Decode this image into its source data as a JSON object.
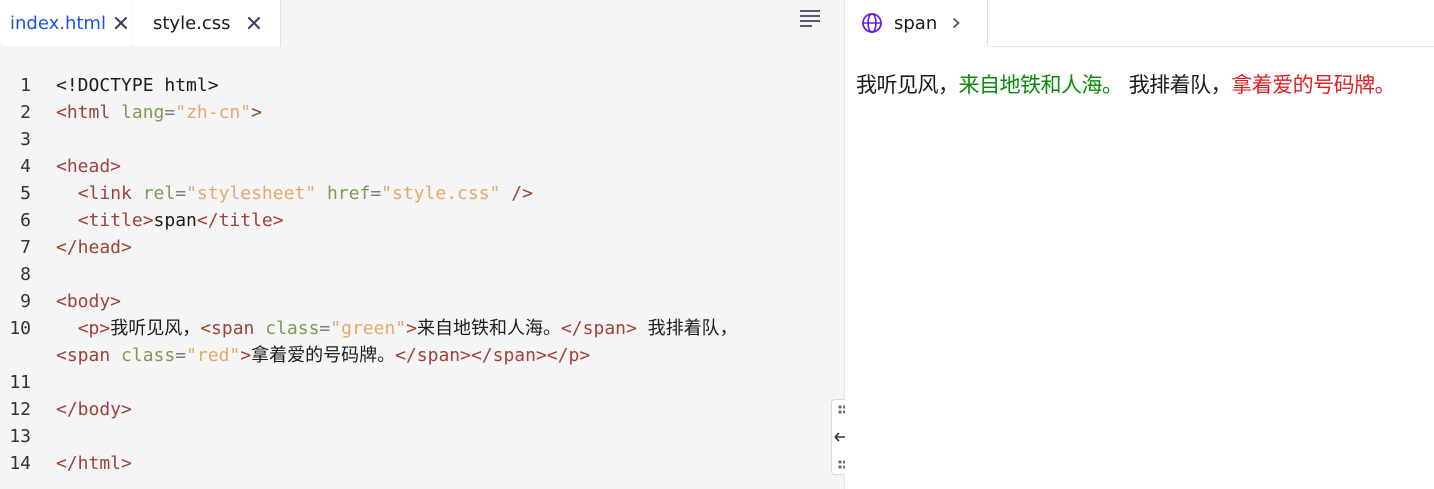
{
  "tabs": [
    {
      "label": "index.html",
      "active": true
    },
    {
      "label": "style.css",
      "active": false
    }
  ],
  "icons": {
    "close": "close-icon",
    "format": "format-lines-icon",
    "globe": "globe-icon",
    "chevron": "chevron-right-icon",
    "drag": "drag-dots-icon",
    "resize": "horizontal-resize-icon"
  },
  "code_lines": [
    {
      "num": "1",
      "tokens": [
        {
          "t": "doctype",
          "v": "<!DOCTYPE html>"
        }
      ]
    },
    {
      "num": "2",
      "tokens": [
        {
          "t": "tag",
          "v": "<html"
        },
        {
          "t": "text",
          "v": " "
        },
        {
          "t": "attr",
          "v": "lang"
        },
        {
          "t": "punct",
          "v": "="
        },
        {
          "t": "str",
          "v": "\"zh-cn\""
        },
        {
          "t": "tag",
          "v": ">"
        }
      ]
    },
    {
      "num": "3",
      "tokens": []
    },
    {
      "num": "4",
      "tokens": [
        {
          "t": "tag",
          "v": "<head>"
        }
      ]
    },
    {
      "num": "5",
      "tokens": [
        {
          "t": "text",
          "v": "  "
        },
        {
          "t": "tag",
          "v": "<link"
        },
        {
          "t": "text",
          "v": " "
        },
        {
          "t": "attr",
          "v": "rel"
        },
        {
          "t": "punct",
          "v": "="
        },
        {
          "t": "str",
          "v": "\"stylesheet\""
        },
        {
          "t": "text",
          "v": " "
        },
        {
          "t": "attr",
          "v": "href"
        },
        {
          "t": "punct",
          "v": "="
        },
        {
          "t": "str",
          "v": "\"style.css\""
        },
        {
          "t": "text",
          "v": " "
        },
        {
          "t": "tag",
          "v": "/>"
        }
      ]
    },
    {
      "num": "6",
      "tokens": [
        {
          "t": "text",
          "v": "  "
        },
        {
          "t": "tag",
          "v": "<title>"
        },
        {
          "t": "text",
          "v": "span"
        },
        {
          "t": "tag",
          "v": "</title>"
        }
      ]
    },
    {
      "num": "7",
      "tokens": [
        {
          "t": "tag",
          "v": "</head>"
        }
      ]
    },
    {
      "num": "8",
      "tokens": []
    },
    {
      "num": "9",
      "tokens": [
        {
          "t": "tag",
          "v": "<body>"
        }
      ]
    },
    {
      "num": "10",
      "tokens": [
        {
          "t": "text",
          "v": "  "
        },
        {
          "t": "tag",
          "v": "<p>"
        },
        {
          "t": "cjk",
          "v": "我听见风，"
        },
        {
          "t": "tag",
          "v": "<span"
        },
        {
          "t": "text",
          "v": " "
        },
        {
          "t": "attr",
          "v": "class"
        },
        {
          "t": "punct",
          "v": "="
        },
        {
          "t": "str",
          "v": "\"green\""
        },
        {
          "t": "tag",
          "v": ">"
        },
        {
          "t": "cjk",
          "v": "来自地铁和人海。"
        },
        {
          "t": "tag",
          "v": "</span>"
        },
        {
          "t": "text",
          "v": " "
        },
        {
          "t": "cjk",
          "v": "我排着队，"
        }
      ]
    },
    {
      "num": "",
      "tokens": [
        {
          "t": "tag",
          "v": "<span"
        },
        {
          "t": "text",
          "v": " "
        },
        {
          "t": "attr",
          "v": "class"
        },
        {
          "t": "punct",
          "v": "="
        },
        {
          "t": "str",
          "v": "\"red\""
        },
        {
          "t": "tag",
          "v": ">"
        },
        {
          "t": "cjk",
          "v": "拿着爱的号码牌。"
        },
        {
          "t": "tag",
          "v": "</span></span></p>"
        }
      ]
    },
    {
      "num": "11",
      "tokens": []
    },
    {
      "num": "12",
      "tokens": [
        {
          "t": "tag",
          "v": "</body>"
        }
      ]
    },
    {
      "num": "13",
      "tokens": []
    },
    {
      "num": "14",
      "tokens": [
        {
          "t": "tag",
          "v": "</html>"
        }
      ]
    }
  ],
  "preview": {
    "tab_label": "span",
    "text_plain_1": "我听见风，",
    "text_green": "来自地铁和人海。",
    "text_plain_2": " 我排着队，",
    "text_red": "拿着爱的号码牌。"
  },
  "colors": {
    "active_tab_text": "#1a56db",
    "green_text": "#0b8a0b",
    "red_text": "#e02020",
    "tag": "#a0413a",
    "attribute": "#7b9b55",
    "string": "#e6a868"
  }
}
